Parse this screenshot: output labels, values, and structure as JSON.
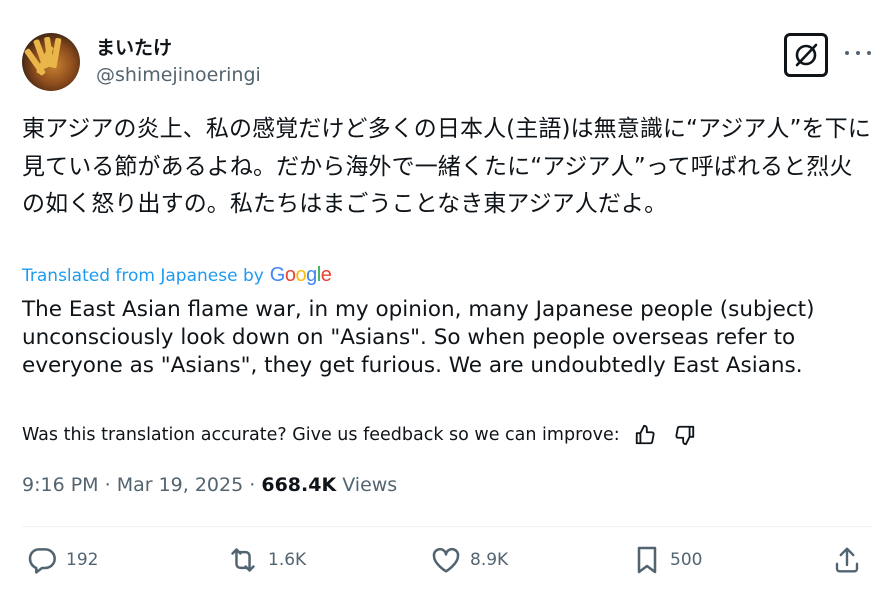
{
  "author": {
    "display_name": "まいたけ",
    "handle": "@shimejinoeringi"
  },
  "tweet": {
    "original_text": "東アジアの炎上、私の感覚だけど多くの日本人(主語)は無意識に“アジア人”を下に見ている節があるよね。だから海外で一緒くたに“アジア人”って呼ばれると烈火の如く怒り出すの。私たちはまごうことなき東アジア人だよ。",
    "translated_from": "Translated from Japanese by",
    "translator_brand": "Google",
    "translated_text": "The East Asian flame war, in my opinion, many Japanese people (subject) unconsciously look down on \"Asians\". So when people overseas refer to everyone as \"Asians\", they get furious. We are undoubtedly East Asians.",
    "feedback_prompt": "Was this translation accurate? Give us feedback so we can improve:"
  },
  "meta": {
    "time": "9:16 PM",
    "separator": "·",
    "date": "Mar 19, 2025",
    "views_count": "668.4K",
    "views_label": "Views"
  },
  "actions": {
    "replies": "192",
    "reposts": "1.6K",
    "likes": "8.9K",
    "bookmarks": "500"
  },
  "icons": [
    "grok-icon",
    "more-icon",
    "thumbs-up-icon",
    "thumbs-down-icon",
    "reply-icon",
    "repost-icon",
    "like-icon",
    "bookmark-icon",
    "share-icon"
  ],
  "colors": {
    "text": "#0f1419",
    "secondary": "#536471",
    "link": "#1d9bf0",
    "divider": "#eff3f4"
  }
}
